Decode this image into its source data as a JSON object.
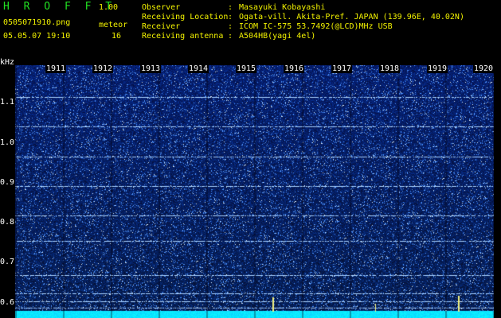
{
  "header": {
    "app_name": "H R O F F T",
    "version": "1.00",
    "filename": "0505071910.png",
    "datetime": "05.05.07 19:10",
    "meteor_label": "meteor",
    "meteor_count": "16"
  },
  "info": [
    {
      "label": "Observer",
      "value": "Masayuki Kobayashi"
    },
    {
      "label": "Receiving Location",
      "value": "Ogata-vill. Akita-Pref. JAPAN (139.96E, 40.02N)"
    },
    {
      "label": "Receiver",
      "value": "ICOM IC-575 53.7492(@LCD)MHz USB"
    },
    {
      "label": "Receiving antenna",
      "value": "A504HB(yagi 4el)"
    }
  ],
  "axis": {
    "unit": "kHz",
    "y_ticks": [
      "1.1",
      "1.0",
      "0.9",
      "0.8",
      "0.7",
      "0.6"
    ],
    "hours": [
      "1911",
      "1912",
      "1913",
      "1914",
      "1915",
      "1916",
      "1917",
      "1918",
      "1919",
      "1920"
    ]
  },
  "colors": {
    "background": "#000000",
    "spectrogram_base": "#0a1a8a",
    "signal": "#ffffff",
    "header_green": "#22e022",
    "header_yellow": "#f2f200"
  }
}
